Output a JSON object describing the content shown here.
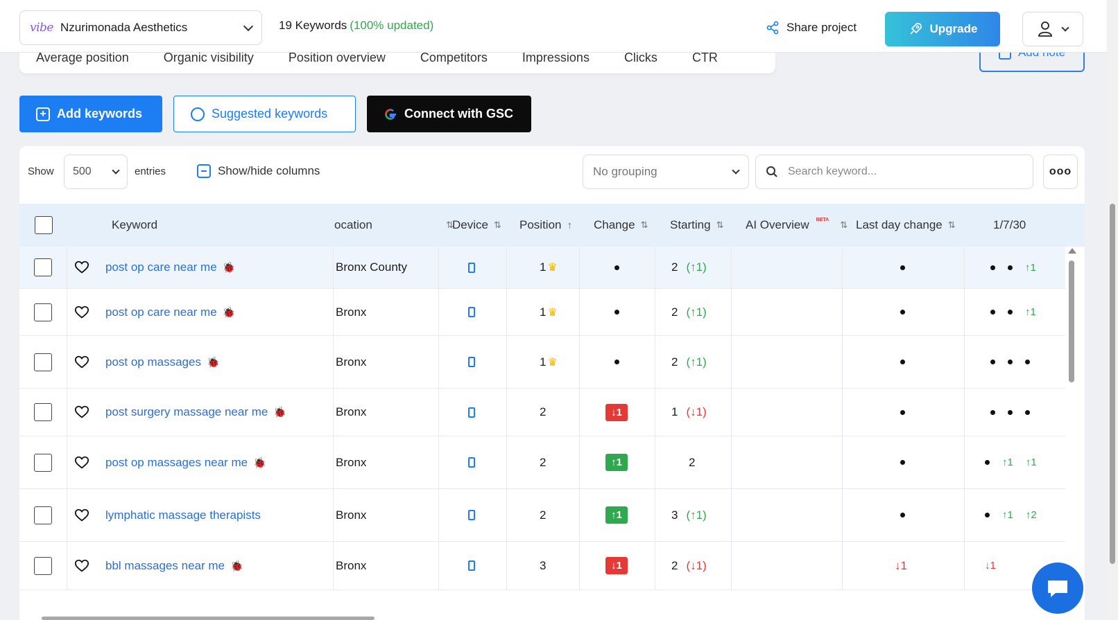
{
  "header": {
    "logo_text": "vibe",
    "project_name": "Nzurimonada Aesthetics",
    "keyword_count": "19 Keywords",
    "updated_status": "(100% updated)",
    "share_label": "Share project",
    "upgrade_label": "Upgrade"
  },
  "tabs": [
    "Average position",
    "Organic visibility",
    "Position overview",
    "Competitors",
    "Impressions",
    "Clicks",
    "CTR"
  ],
  "add_note_label": "Add note",
  "actions": {
    "add_keywords": "Add keywords",
    "suggested_keywords": "Suggested keywords",
    "connect_gsc": "Connect with GSC"
  },
  "controls": {
    "show_label": "Show",
    "entries_value": "500",
    "entries_label": "entries",
    "show_hide_label": "Show/hide columns",
    "grouping_value": "No grouping",
    "search_placeholder": "Search keyword...",
    "more_label": "ooo"
  },
  "columns": {
    "keyword": "Keyword",
    "location": "ocation",
    "device": "Device",
    "position": "Position",
    "change": "Change",
    "starting": "Starting",
    "ai_overview": "AI Overview",
    "ai_badge": "BETA",
    "last_day_change": "Last day change",
    "trend": "1/7/30"
  },
  "rows": [
    {
      "keyword": "post op care near me",
      "location": "Bronx County",
      "position": "1",
      "top": true,
      "change": "",
      "change_type": "none",
      "starting": "2",
      "starting_delta": "(↑1)",
      "starting_dir": "up",
      "last_day": "",
      "last_day_type": "dot",
      "trend": [
        "",
        "",
        "↑1"
      ],
      "trend_types": [
        "dot",
        "dot",
        "up"
      ]
    },
    {
      "keyword": "post op care near me",
      "location": "Bronx",
      "position": "1",
      "top": true,
      "change": "",
      "change_type": "none",
      "starting": "2",
      "starting_delta": "(↑1)",
      "starting_dir": "up",
      "last_day": "",
      "last_day_type": "dot",
      "trend": [
        "",
        "",
        "↑1"
      ],
      "trend_types": [
        "dot",
        "dot",
        "up"
      ]
    },
    {
      "keyword": "post op massages",
      "location": "Bronx",
      "position": "1",
      "top": true,
      "change": "",
      "change_type": "none",
      "starting": "2",
      "starting_delta": "(↑1)",
      "starting_dir": "up",
      "last_day": "",
      "last_day_type": "dot",
      "trend": [
        "",
        "",
        ""
      ],
      "trend_types": [
        "dot",
        "dot",
        "dot"
      ]
    },
    {
      "keyword": "post surgery massage near me",
      "location": "Bronx",
      "position": "2",
      "top": false,
      "change": "↓1",
      "change_type": "red",
      "starting": "1",
      "starting_delta": "(↓1)",
      "starting_dir": "down",
      "last_day": "",
      "last_day_type": "dot",
      "trend": [
        "",
        "",
        ""
      ],
      "trend_types": [
        "dot",
        "dot",
        "dot"
      ]
    },
    {
      "keyword": "post op massages near me",
      "location": "Bronx",
      "position": "2",
      "top": false,
      "change": "↑1",
      "change_type": "green",
      "starting": "2",
      "starting_delta": "",
      "starting_dir": "none",
      "last_day": "",
      "last_day_type": "dot",
      "trend": [
        "",
        "↑1",
        "↑1"
      ],
      "trend_types": [
        "dot",
        "up",
        "up"
      ]
    },
    {
      "keyword": "lymphatic massage therapists",
      "location": "Bronx",
      "position": "2",
      "top": false,
      "change": "↑1",
      "change_type": "green",
      "starting": "3",
      "starting_delta": "(↑1)",
      "starting_dir": "up",
      "last_day": "",
      "last_day_type": "dot",
      "trend": [
        "",
        "↑1",
        "↑2"
      ],
      "trend_types": [
        "dot",
        "up",
        "up"
      ]
    },
    {
      "keyword": "bbl massages near me",
      "location": "Bronx",
      "position": "3",
      "top": false,
      "change": "↓1",
      "change_type": "red",
      "starting": "2",
      "starting_delta": "(↓1)",
      "starting_dir": "down",
      "last_day": "↓1",
      "last_day_type": "down",
      "trend": [
        "↓1"
      ],
      "trend_types": [
        "down"
      ]
    }
  ],
  "row_bug_flags": [
    true,
    true,
    true,
    true,
    true,
    false,
    true
  ],
  "colors": {
    "accent": "#1c7ef2",
    "up": "#2fa84f",
    "down": "#e53935",
    "link": "#2c6fd0"
  }
}
